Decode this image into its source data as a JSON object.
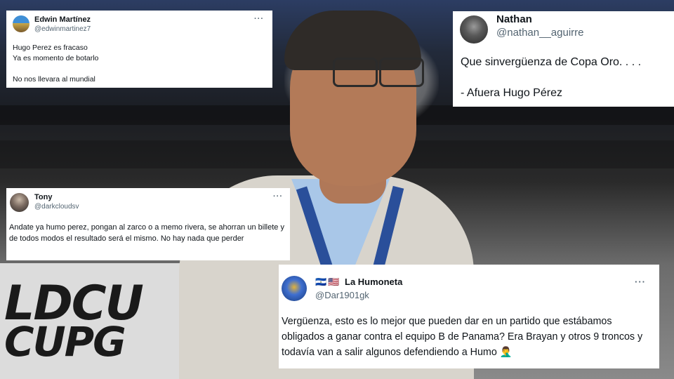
{
  "tweets": [
    {
      "name": "Edwin Martínez",
      "handle": "@edwinmartinez7",
      "more": "···",
      "text": "Hugo Perez es fracaso\nYa es momento de botarlo\n\nNo nos llevara al mundial"
    },
    {
      "name": "Nathan",
      "handle": "@nathan__aguirre",
      "text": "Que sinvergüenza de Copa Oro. . . .\n\n- Afuera Hugo Pérez"
    },
    {
      "name": "Tony",
      "handle": "@darkcloudsv",
      "more": "···",
      "text": "Andate ya humo perez, pongan al zarco o a memo rivera, se ahorran un billete y de todos modos el resultado será el mismo. No hay nada que perder"
    },
    {
      "name": "La Humoneta",
      "handle": "@Dar1901gk",
      "more": "···",
      "text": "Vergüenza, esto es lo mejor que pueden dar en un partido que estábamos obligados a ganar contra el equipo B de Panama? Era Brayan y otros 9 troncos y todavía van a salir algunos defendiendo a Humo",
      "flags": [
        "🇸🇻",
        "🇺🇸"
      ],
      "emoji": "🤦‍♂️"
    }
  ],
  "background": {
    "board_text_1": "LDCU",
    "board_text_2": "CUPG"
  },
  "colors": {
    "handle": "#536471",
    "text": "#0f1419",
    "card": "#ffffff"
  }
}
